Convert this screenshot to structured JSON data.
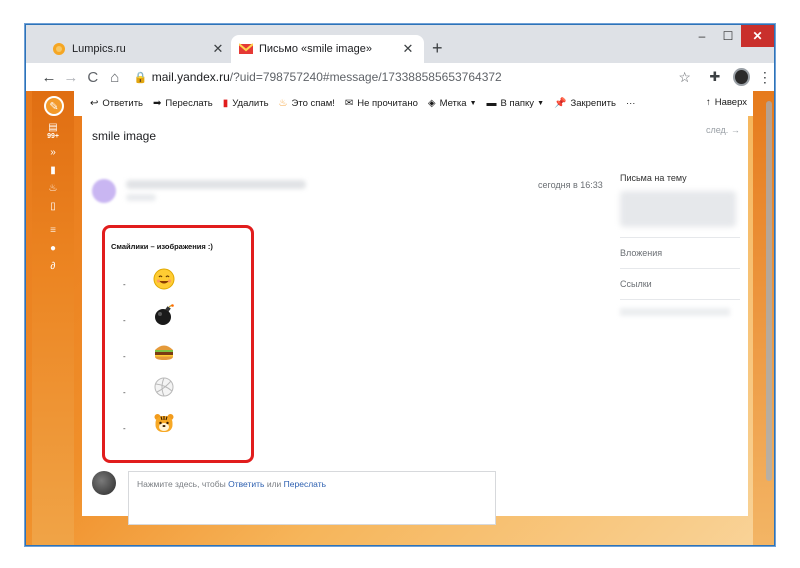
{
  "browser": {
    "tabs": [
      {
        "title": "Lumpics.ru",
        "active": false
      },
      {
        "title": "Письмо «smile image»",
        "active": true
      }
    ],
    "new_tab": "+",
    "url_host": "mail.yandex.ru",
    "url_rest": "/?uid=798757240#message/173388585653764372",
    "window_controls": {
      "minimize": "–",
      "maximize": "☐",
      "close": "✕"
    }
  },
  "mail_toolbar": {
    "reply": "Ответить",
    "forward": "Переслать",
    "delete": "Удалить",
    "spam": "Это спам!",
    "unread": "Не прочитано",
    "label": "Метка",
    "folder": "В папку",
    "pin": "Закрепить",
    "more": "···",
    "up": "Наверх"
  },
  "left_nav": {
    "badge": "99+"
  },
  "message": {
    "subject": "smile image",
    "next": "след.",
    "date": "сегодня в 16:33",
    "body_title": "Смайлики – изображения :)",
    "emoji_items": [
      "-",
      "-",
      "-",
      "-",
      "-"
    ],
    "emoji_names": [
      "smiling-face-emoji",
      "bomb-emoji",
      "hamburger-emoji",
      "volleyball-emoji",
      "tiger-emoji"
    ]
  },
  "sidebar": {
    "related": "Письма на тему",
    "attachments": "Вложения",
    "links": "Ссылки"
  },
  "reply_box": {
    "prefix": "Нажмите здесь, чтобы ",
    "reply_link": "Ответить",
    "or": " или ",
    "forward_link": "Переслать"
  },
  "colors": {
    "accent_orange": "#f39a2a",
    "highlight_red": "#e11d1d",
    "link_blue": "#2c5fb0"
  }
}
